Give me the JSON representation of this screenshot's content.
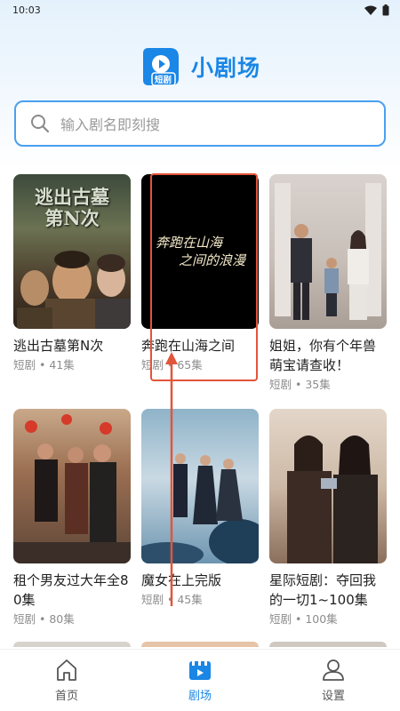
{
  "status": {
    "time": "10:03"
  },
  "app": {
    "logo_badge": "短剧",
    "title": "小剧场"
  },
  "search": {
    "placeholder": "输入剧名即刻搜"
  },
  "dramas": [
    {
      "title": "逃出古墓第N次",
      "meta": "短剧 • 41集",
      "poster_text": "逃出古墓第N次"
    },
    {
      "title": "奔跑在山海之间",
      "meta": "短剧 • 65集",
      "poster_text_1": "奔跑在山海",
      "poster_text_2": "之间的浪漫"
    },
    {
      "title": "姐姐，你有个年兽萌宝请查收！",
      "meta": "短剧 • 35集"
    },
    {
      "title": "租个男友过大年全80集",
      "meta": "短剧 • 80集"
    },
    {
      "title": "魔女在上完版",
      "meta": "短剧 • 45集"
    },
    {
      "title": "星际短剧：夺回我的一切1~100集",
      "meta": "短剧 • 100集"
    }
  ],
  "tabs": [
    {
      "label": "首页",
      "icon": "home-icon",
      "active": false
    },
    {
      "label": "剧场",
      "icon": "theater-icon",
      "active": true
    },
    {
      "label": "设置",
      "icon": "user-icon",
      "active": false
    }
  ],
  "colors": {
    "accent": "#1a86e6",
    "highlight": "#e2553b"
  }
}
